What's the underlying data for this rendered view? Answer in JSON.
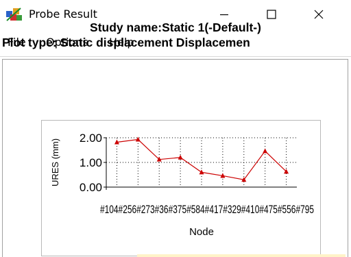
{
  "window": {
    "title": "Probe Result",
    "icon": "probe-result-app-icon",
    "controls": [
      "minimize-icon",
      "maximize-icon",
      "close-icon"
    ]
  },
  "menu": {
    "items": [
      "File",
      "Options",
      "Help"
    ]
  },
  "header": {
    "study_name": "Study name:Static 1(-Default-)",
    "plot_type": "Plot type: Static displacement Displacemen"
  },
  "chart_data": {
    "type": "line",
    "xlabel": "Node",
    "ylabel": "URES (mm)",
    "ylim": [
      0,
      2
    ],
    "yticks": [
      "0.00",
      "1.00",
      "2.00"
    ],
    "grid": true,
    "categories": [
      "#104",
      "#256",
      "#273",
      "#36",
      "#375",
      "#584",
      "#417",
      "#329",
      "#410",
      "#475",
      "#556",
      "#795"
    ],
    "xtick_text": "#104#256#273#36#375#584#417#329#410#475#556#795",
    "series": [
      {
        "values": [
          1.82,
          1.93,
          1.12,
          1.2,
          0.6,
          0.46,
          0.3,
          1.46,
          0.63
        ],
        "color": "#cc0000"
      }
    ]
  },
  "colors": {
    "series": "#cc0000",
    "grid": "#000000"
  }
}
